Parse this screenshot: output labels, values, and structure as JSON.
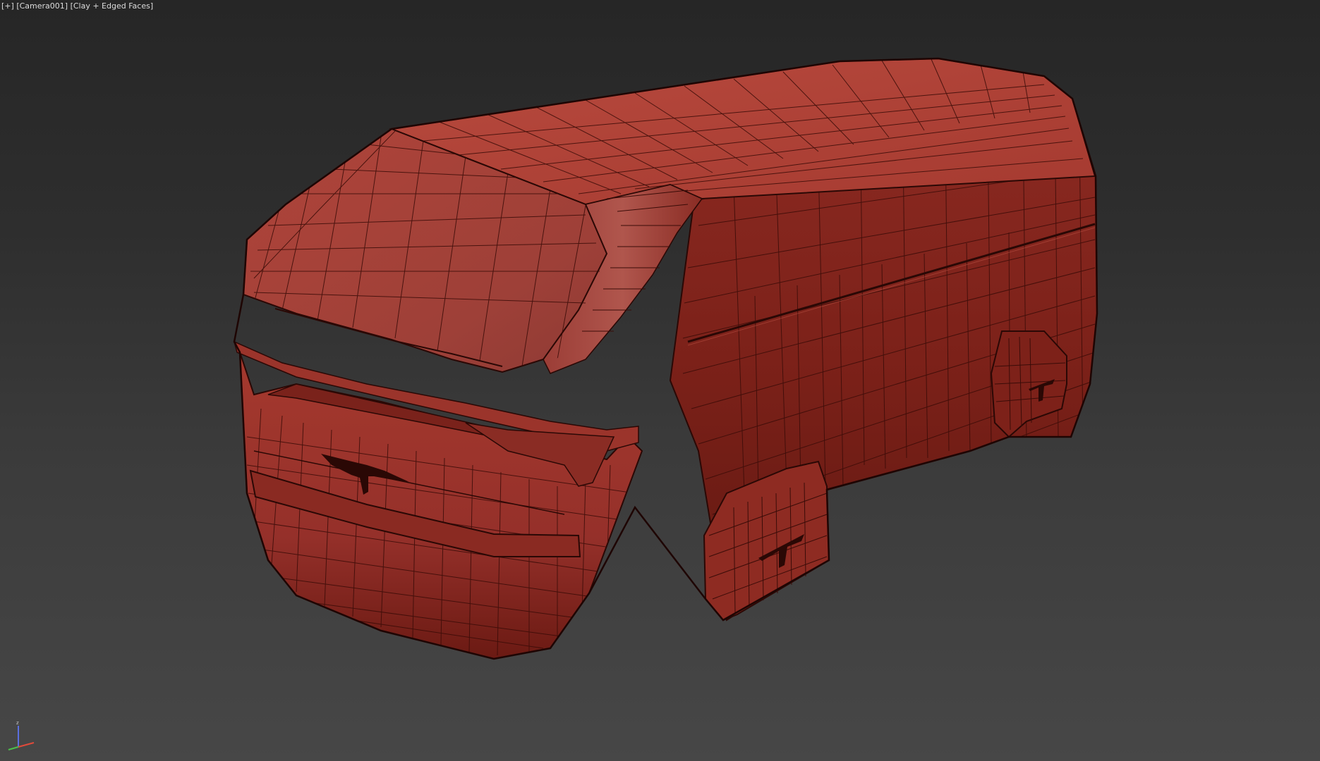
{
  "viewport": {
    "label_plus": "[+]",
    "label_camera": "[Camera001]",
    "label_shading": "[Clay + Edged Faces]",
    "axis_z_label": "z",
    "model_color": "#b13c30",
    "wire_color": "#3a0c08",
    "background_top": "#262626",
    "background_bottom": "#474747"
  }
}
